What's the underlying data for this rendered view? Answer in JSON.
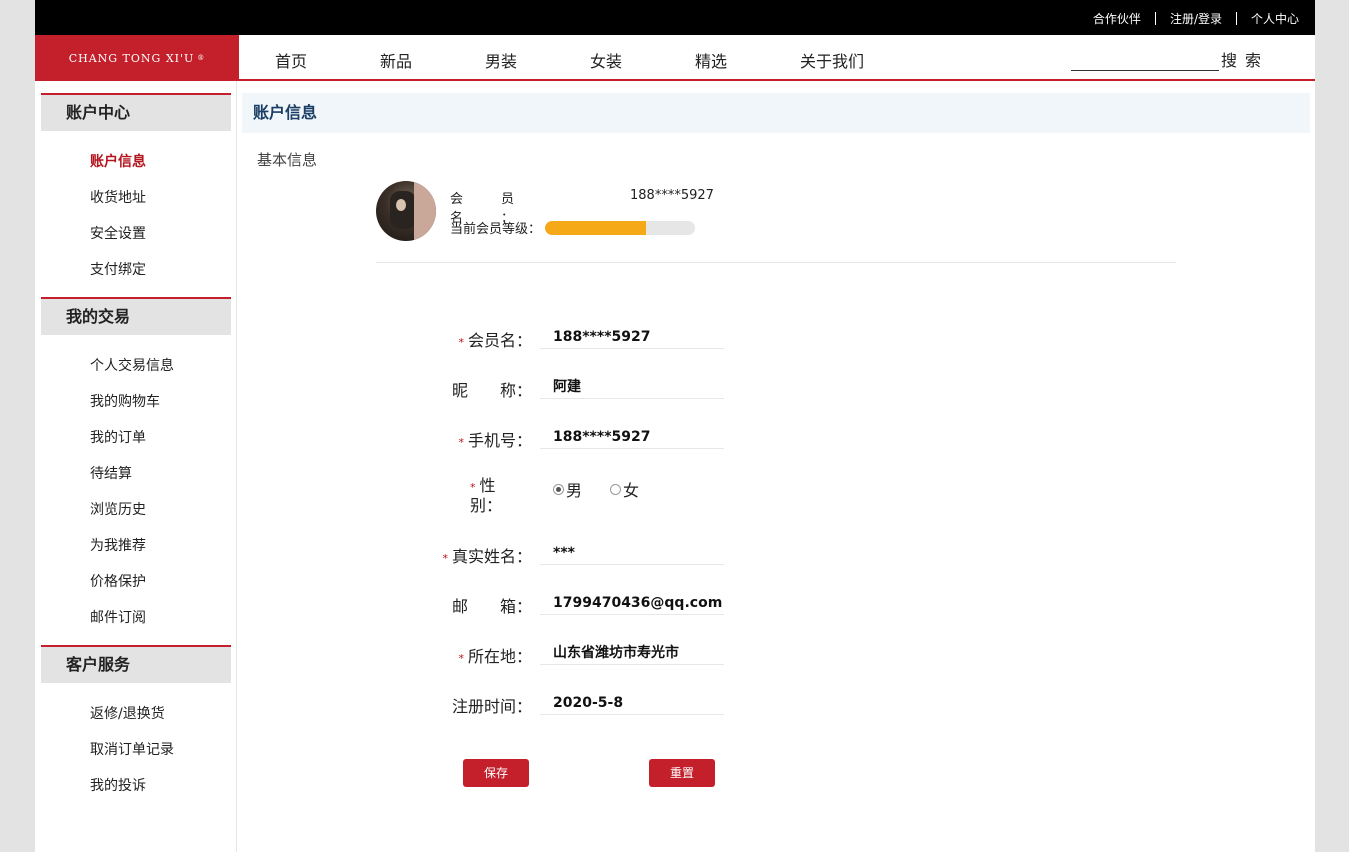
{
  "topbar": {
    "links": [
      "合作伙伴",
      "注册/登录",
      "个人中心"
    ]
  },
  "nav": {
    "logo": "CHANG TONG XI'U",
    "logo_mark": "®",
    "items": [
      "首页",
      "新品",
      "男装",
      "女装",
      "精选",
      "关于我们"
    ],
    "search_placeholder": "",
    "search_button": "搜索"
  },
  "sidebar": {
    "sections": [
      {
        "title": "账户中心",
        "items": [
          "账户信息",
          "收货地址",
          "安全设置",
          "支付绑定"
        ]
      },
      {
        "title": "我的交易",
        "items": [
          "个人交易信息",
          "我的购物车",
          "我的订单",
          "待结算",
          "浏览历史",
          "为我推荐",
          "价格保护",
          "邮件订阅"
        ]
      },
      {
        "title": "客户服务",
        "items": [
          "返修/退换货",
          "取消订单记录",
          "我的投诉"
        ]
      }
    ],
    "active_item": "账户信息"
  },
  "content": {
    "header": "账户信息",
    "basic_title": "基本信息",
    "member_label": "会员名：",
    "member_value": "188****5927",
    "level_label": "当前会员等级：",
    "level_progress": 0.67,
    "level_color": "#f5a917"
  },
  "form": {
    "fields": [
      {
        "label": "会员名：",
        "required": true,
        "value": "188****5927"
      },
      {
        "label": "昵　　称：",
        "required": false,
        "value": "阿建"
      },
      {
        "label": "手机号：",
        "required": true,
        "value": "188****5927"
      },
      {
        "label": "性　　别：",
        "required": true,
        "type": "radio"
      },
      {
        "label": "真实姓名：",
        "required": true,
        "value": "***"
      },
      {
        "label": "邮　　箱：",
        "required": false,
        "value": "1799470436@qq.com"
      },
      {
        "label": "所在地：",
        "required": true,
        "value": "山东省潍坊市寿光市"
      },
      {
        "label": "注册时间：",
        "required": false,
        "value": "2020-5-8"
      }
    ],
    "gender_options": [
      "男",
      "女"
    ],
    "gender_selected": "男",
    "required_mark": "*",
    "save_label": "保存",
    "reset_label": "重置"
  },
  "colors": {
    "brand": "#c4202b",
    "active": "#b4141e",
    "header_text": "#1b3e66"
  }
}
